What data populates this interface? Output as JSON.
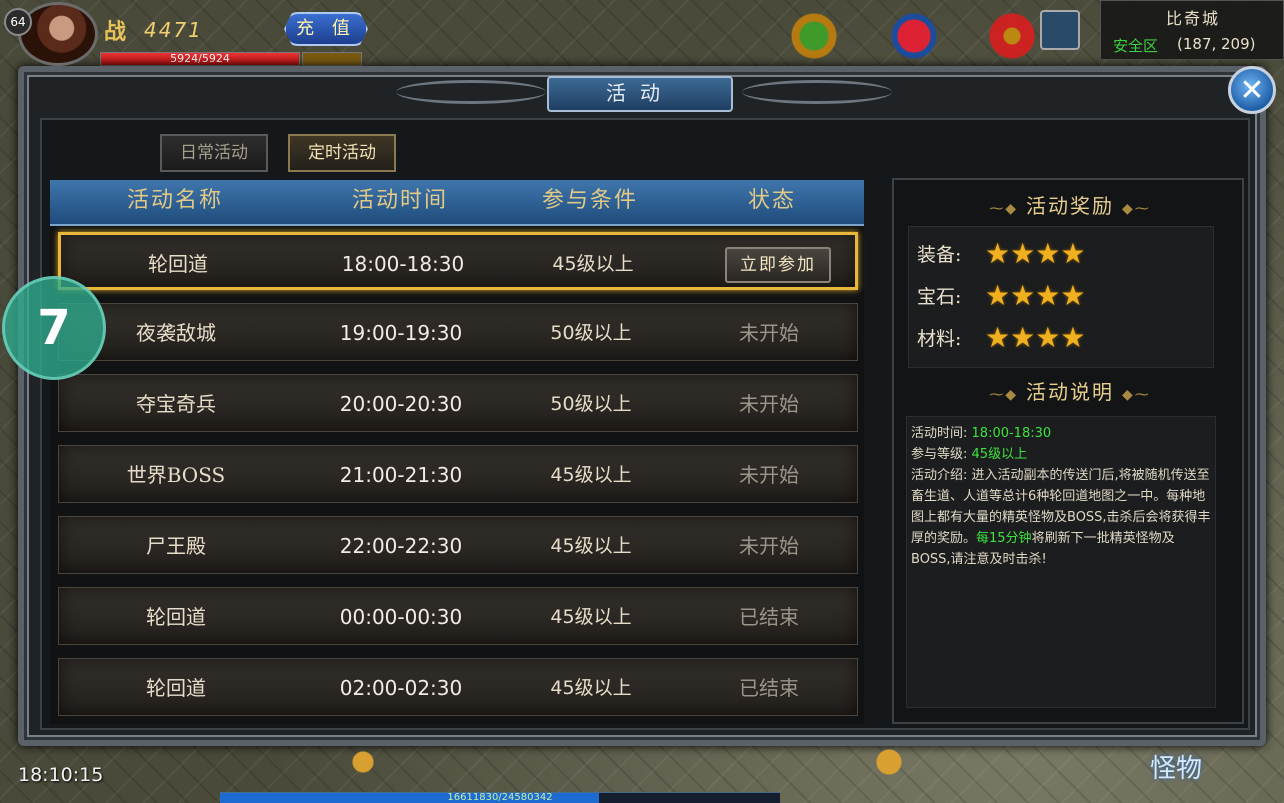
{
  "hud": {
    "level": "64",
    "power_icon": "战",
    "power_value": "4471",
    "recharge_label": "充 值",
    "hp_text": "5924/5924",
    "hp_fraction": 1.0,
    "map_name": "比奇城",
    "zone": "安全区",
    "coords": "(187, 209)",
    "clock": "18:10:15",
    "monster_label": "怪物",
    "exp_text": "16611830/24580342",
    "exp_fraction": 0.676,
    "float_label": "7"
  },
  "dialog": {
    "title": "活动",
    "tabs": [
      {
        "label": "日常活动"
      },
      {
        "label": "定时活动"
      }
    ],
    "columns": [
      "活动名称",
      "活动时间",
      "参与条件",
      "状态"
    ],
    "rows": [
      {
        "name": "轮回道",
        "time": "18:00-18:30",
        "level": "45级以上",
        "status": "立即参加",
        "selected": true
      },
      {
        "name": "夜袭敌城",
        "time": "19:00-19:30",
        "level": "50级以上",
        "status": "未开始"
      },
      {
        "name": "夺宝奇兵",
        "time": "20:00-20:30",
        "level": "50级以上",
        "status": "未开始"
      },
      {
        "name": "世界BOSS",
        "time": "21:00-21:30",
        "level": "45级以上",
        "status": "未开始"
      },
      {
        "name": "尸王殿",
        "time": "22:00-22:30",
        "level": "45级以上",
        "status": "未开始"
      },
      {
        "name": "轮回道",
        "time": "00:00-00:30",
        "level": "45级以上",
        "status": "已结束"
      },
      {
        "name": "轮回道",
        "time": "02:00-02:30",
        "level": "45级以上",
        "status": "已结束"
      }
    ],
    "rewards_title": "活动奖励",
    "rewards": [
      {
        "label": "装备:",
        "stars": 4
      },
      {
        "label": "宝石:",
        "stars": 4
      },
      {
        "label": "材料:",
        "stars": 4
      }
    ],
    "desc_title": "活动说明",
    "desc": {
      "time_label": "活动时间:",
      "time_value": "18:00-18:30",
      "level_label": "参与等级:",
      "level_value": "45级以上",
      "intro_a": "活动介绍: 进入活动副本的传送门后,将被随机传送至畜生道、人道等总计6种轮回道地图之一中。每种地图上都有大量的精英怪物及BOSS,击杀后会将获得丰厚的奖励。",
      "intro_green": "每15分钟",
      "intro_b": "将刷新下一批精英怪物及BOSS,请注意及时击杀!"
    }
  },
  "colors": {
    "accent_gold": "#e8b83a",
    "header_blue": "#2f6298",
    "green_text": "#3ee23e"
  },
  "icons": {
    "close": "close-icon",
    "star": "star-icon"
  }
}
